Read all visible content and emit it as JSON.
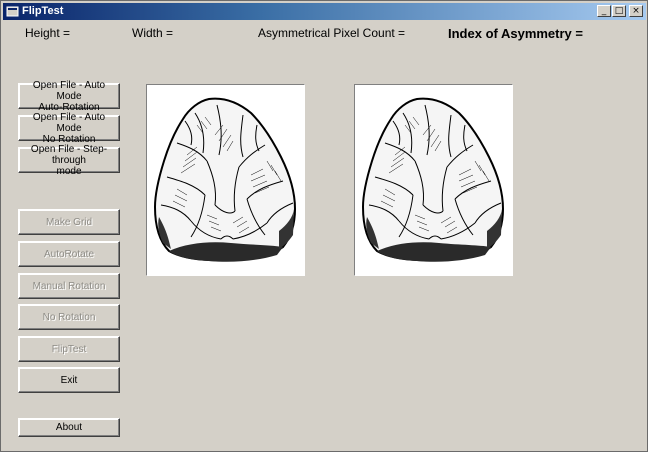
{
  "window": {
    "title": "FlipTest",
    "title_icon": "app-icon",
    "controls": {
      "minimize": "_",
      "maximize": "□",
      "close": "×"
    }
  },
  "info": {
    "height": "Height =",
    "width": "Width =",
    "asym_count": "Asymmetrical Pixel Count =",
    "index_asym": "Index of Asymmetry ="
  },
  "buttons": {
    "auto_rotation": [
      "Open File - Auto Mode",
      "Auto-Rotation"
    ],
    "auto_norotation": [
      "Open File - Auto Mode",
      "No Rotation"
    ],
    "step_through": [
      "Open File - Step-through",
      "mode"
    ],
    "make_grid": "Make Grid",
    "autorotate": "AutoRotate",
    "manual_rotation": "Manual Rotation",
    "no_rotation": "No Rotation",
    "fliptest": "FlipTest",
    "exit": "Exit",
    "about": "About"
  },
  "images": {
    "left": "handaxe-original-image",
    "right": "handaxe-flipped-image"
  }
}
